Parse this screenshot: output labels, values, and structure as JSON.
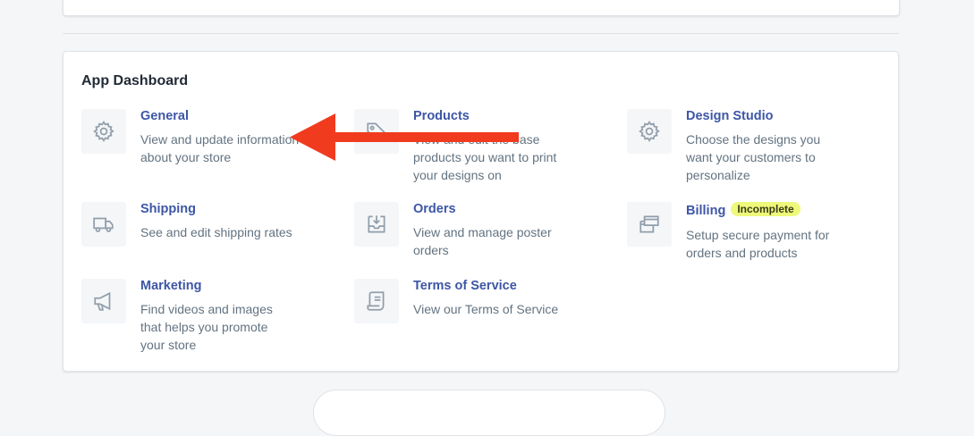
{
  "dashboard": {
    "title": "App Dashboard",
    "items": [
      {
        "title": "General",
        "desc": "View and update information about your store",
        "icon": "gear-icon"
      },
      {
        "title": "Products",
        "desc": "View and edit the base products you want to print your designs on",
        "icon": "tag-icon"
      },
      {
        "title": "Design Studio",
        "desc": "Choose the designs you want your customers to personalize",
        "icon": "gear-icon"
      },
      {
        "title": "Shipping",
        "desc": "See and edit shipping rates",
        "icon": "truck-icon"
      },
      {
        "title": "Orders",
        "desc": "View and manage poster orders",
        "icon": "inbox-download-icon"
      },
      {
        "title": "Billing",
        "badge": "Incomplete",
        "desc": "Setup secure payment for orders and products",
        "icon": "credit-card-icon"
      },
      {
        "title": "Marketing",
        "desc": "Find videos and images that helps you promote your store",
        "icon": "megaphone-icon"
      },
      {
        "title": "Terms of Service",
        "desc": "View our Terms of Service",
        "icon": "document-icon"
      }
    ]
  },
  "colors": {
    "link": "#3d56a6",
    "text_muted": "#637381",
    "badge_bg": "#eef87a",
    "arrow": "#f03b1f",
    "background": "#f4f6f8"
  }
}
